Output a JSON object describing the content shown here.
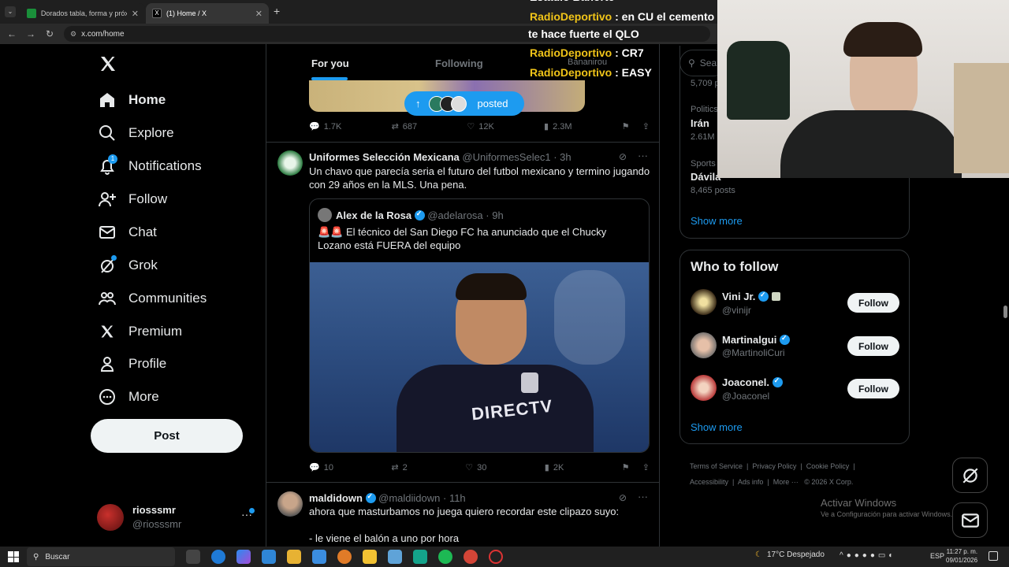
{
  "browser": {
    "tabs": [
      {
        "title": "Dorados tabla, forma y próximo",
        "active": false
      },
      {
        "title": "(1) Home / X",
        "active": true
      }
    ],
    "url": "x.com/home"
  },
  "nav": {
    "items": [
      {
        "label": "Home",
        "icon": "home-icon"
      },
      {
        "label": "Explore",
        "icon": "search-icon"
      },
      {
        "label": "Notifications",
        "icon": "bell-icon",
        "badge": "1"
      },
      {
        "label": "Follow",
        "icon": "add-person-icon"
      },
      {
        "label": "Chat",
        "icon": "mail-icon"
      },
      {
        "label": "Grok",
        "icon": "grok-icon"
      },
      {
        "label": "Communities",
        "icon": "people-icon"
      },
      {
        "label": "Premium",
        "icon": "x-logo-icon"
      },
      {
        "label": "Profile",
        "icon": "person-icon"
      },
      {
        "label": "More",
        "icon": "more-circle-icon"
      }
    ],
    "post_label": "Post",
    "account": {
      "name": "riosssmr",
      "handle": "@riosssmr"
    }
  },
  "feed": {
    "tabs": [
      {
        "label": "For you"
      },
      {
        "label": "Following"
      },
      {
        "label": "Bananirou"
      }
    ],
    "new_posts_label": "posted",
    "top_post": {
      "replies": "1.7K",
      "reposts": "687",
      "likes": "12K",
      "views": "2.3M"
    },
    "post1": {
      "name": "Uniformes Selección Mexicana",
      "handle": "@UniformesSelec1",
      "time": "· 3h",
      "text": "Un chavo que parecía seria el futuro del futbol mexicano y termino jugando con 29 años en la MLS. Una pena.",
      "quote": {
        "name": "Alex de la Rosa",
        "handle": "@adelarosa",
        "time": "· 9h",
        "text_prefix": "🚨🚨",
        "text": "El técnico del San Diego FC ha anunciado que el Chucky Lozano está FUERA del equipo",
        "image_text": "DIRECTV"
      },
      "replies": "10",
      "reposts": "2",
      "likes": "30",
      "views": "2K"
    },
    "post2": {
      "name": "maldidown",
      "handle": "@maldiidown",
      "time": "· 11h",
      "text": "ahora que masturbamos no juega quiero recordar este clipazo suyo:",
      "text2": "- le viene el balón a uno por hora"
    }
  },
  "overlay": {
    "title": "Estadio Banorte",
    "lines": [
      {
        "user": "RadioDeportivo",
        "msg": ": en CU el cemento"
      },
      {
        "user": "",
        "msg": "te hace fuerte el QLO"
      },
      {
        "user": "RadioDeportivo",
        "msg": ": CR7"
      },
      {
        "user": "RadioDeportivo",
        "msg": ": EASY"
      }
    ]
  },
  "trends": {
    "search_placeholder": "Sea",
    "items": [
      {
        "meta": "",
        "name": "",
        "count": "5,709 p"
      },
      {
        "meta": "Politics",
        "name": "Irán",
        "count": "2.61M"
      },
      {
        "meta": "Sports",
        "name": "Dávila",
        "count": "8,465 posts"
      }
    ],
    "show_more": "Show more"
  },
  "who_to_follow": {
    "title": "Who to follow",
    "users": [
      {
        "name": "Vini Jr.",
        "handle": "@vinijr"
      },
      {
        "name": "Martinalgui",
        "handle": "@MartinoliCuri"
      },
      {
        "name": "Joaconel.",
        "handle": "@Joaconel"
      }
    ],
    "follow_label": "Follow",
    "show_more": "Show more"
  },
  "footer": {
    "links": [
      "Terms of Service",
      "Privacy Policy",
      "Cookie Policy",
      "Accessibility",
      "Ads info",
      "More ···"
    ],
    "copyright": "© 2026 X Corp."
  },
  "windows": {
    "activate_title": "Activar Windows",
    "activate_sub": "Ve a Configuración para activar Windows.",
    "search_placeholder": "Buscar",
    "weather": "17°C  Despejado",
    "lang": "ESP",
    "time": "11:27 p. m.",
    "date": "09/01/2026"
  },
  "colors": {
    "accent": "#1d9bf0",
    "background": "#000000",
    "border": "#2f3336",
    "muted": "#71767b",
    "overlay_yellow": "#f0c419"
  }
}
